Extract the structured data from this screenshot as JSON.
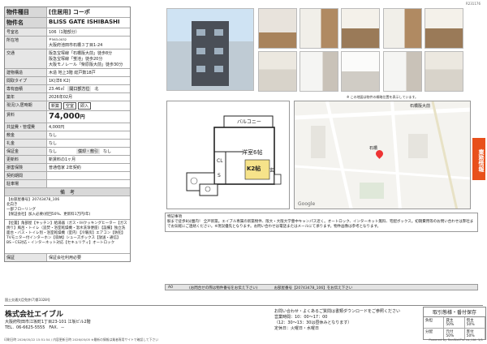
{
  "page_number": "R231176",
  "spec": {
    "type_label": "物件種目",
    "type_value": "[住居用] コーポ",
    "name_label": "物件名",
    "name_value": "BLISS GATE ISHIBASHI",
    "room_label": "号室名",
    "room_value": "106（1階部分）",
    "addr_label": "所在地",
    "zip": "〒563-0032",
    "addr_value": "大阪府池田市石橋３丁目1-24",
    "traffic_label": "交通",
    "traffic": [
      "阪急宝塚線「石橋阪大前」徒歩8分",
      "阪急宝塚線「蛍池」徒歩20分",
      "大阪モノレール「柴原阪大前」徒歩30分"
    ],
    "structure_label": "建物構造",
    "structure_value": "木造 地上3階 総戸数18戸",
    "layout_label": "間取タイプ",
    "layout_value": "1K(洋6 K2)",
    "area_label": "専有面積",
    "area_value": "23.46㎡",
    "direction_label": "開口部方位",
    "direction_value": "北",
    "built_label": "築年",
    "built_value": "2026年02月",
    "status_label": "現況/入居時期",
    "status_tags": [
      "新築",
      "空室",
      "即入"
    ],
    "rent_label": "賃料",
    "rent_value": "74,000",
    "rent_unit": "円",
    "fee_label": "共益費・管理費",
    "fee_value": "4,000円",
    "deposit_label": "敷金",
    "deposit_value": "なし",
    "key_label": "礼金",
    "key_value": "なし",
    "keep_label": "保証金",
    "keep_value": "なし",
    "amort_label": "償却・敷引",
    "amort_value": "なし",
    "renew_label": "更新料",
    "renew_value": "新賃料の1ヶ月",
    "insurance_label": "損害保険",
    "insurance_value": "普通借家 2年契約",
    "lease_label": "契約期間",
    "lease_value": "",
    "parking_label": "駐車場",
    "parking_value": "",
    "notes_header": "備　考",
    "notes": [
      "【お部屋番号】20743478_106",
      "北向き",
      "一部フローリング",
      "【保証会社】加入必要(初回50%、更新料1万円/年)"
    ],
    "facilities": "【位置】角部屋【キッチン】給湯器（ガス・IHクッキングヒーター【ガス焼り】風呂・トイレ（追焚・浴室乾燥機・温水洗浄便座）【設備】独立洗面台・バス・トイレ別・浴室乾燥機（室内）【冷暖房】エアコン【防犯】TVモニター付インターホン【収納】シューズボックス【放送・通信】BS・CS対応・インターネット対応【セキュリティ】オートロック",
    "guarantee_label": "保証",
    "guarantee_value": "保証会社利用必要"
  },
  "map": {
    "note": "※ この地図は物件の概略位置を表示しています。",
    "station_label": "石橋阪大前",
    "place_label": "石橋",
    "logo": "Google"
  },
  "floorplan": {
    "balcony": "バルコニー",
    "room": "洋室6帖",
    "kitchen": "K2帖",
    "closet": "CL",
    "shoe": "S",
    "entry": "玄"
  },
  "side_tab": "業務情報",
  "tokki": {
    "title": "特記事項",
    "body": "駅まで徒歩8分圏内！ 全戸新築。エイブル専属の新築物件、阪大・大阪大学豊中キャンパス近く。オートロック、インターネット無料、宅配ボックス。初期費用等のお問い合わせは弊社までお気軽にご連絡ください。※現況優先となります。お問い合わせは電話またはメールにて承ります。物件画像は参考となります。"
  },
  "strip": {
    "label": "A0",
    "text1": "(お問合せの際は物件番号をお伝え下さい)",
    "text2": "お部屋番号【20743478_106】をお伝え下さい"
  },
  "footer": {
    "license": "国土交通大臣免許(7)第3328号",
    "company": "株式会社エイブル",
    "address": "大阪府吹田市江坂町1丁目23-101 江坂ビル2階",
    "tel": "TEL．06-6625-5555　FAX．－",
    "contact_lines": [
      "お問い合わせ・よくあるご質問は書類ダウンロードをご参照ください",
      "営業時間：10：00〜17：00",
      "（12：30〜13：30は昼休みとなります）",
      "定休日：火曜日・水曜日"
    ],
    "deal_header": "取引態様・番付保存",
    "deal_rows": [
      [
        "負担",
        "貸主 50%",
        "借主 50%"
      ],
      [
        "分配",
        "元付 50%",
        "客付 50%"
      ]
    ],
    "printed": "印刷日時 2026/05/22 15:51:54 / 内容更新日時 2026/05/05 ※最新の情報は業者専用サイトで確認して下さい",
    "powered": "Powered by RealNetPro co.,Ltd. 1/1"
  },
  "colors": {
    "accent": "#e8501b"
  }
}
